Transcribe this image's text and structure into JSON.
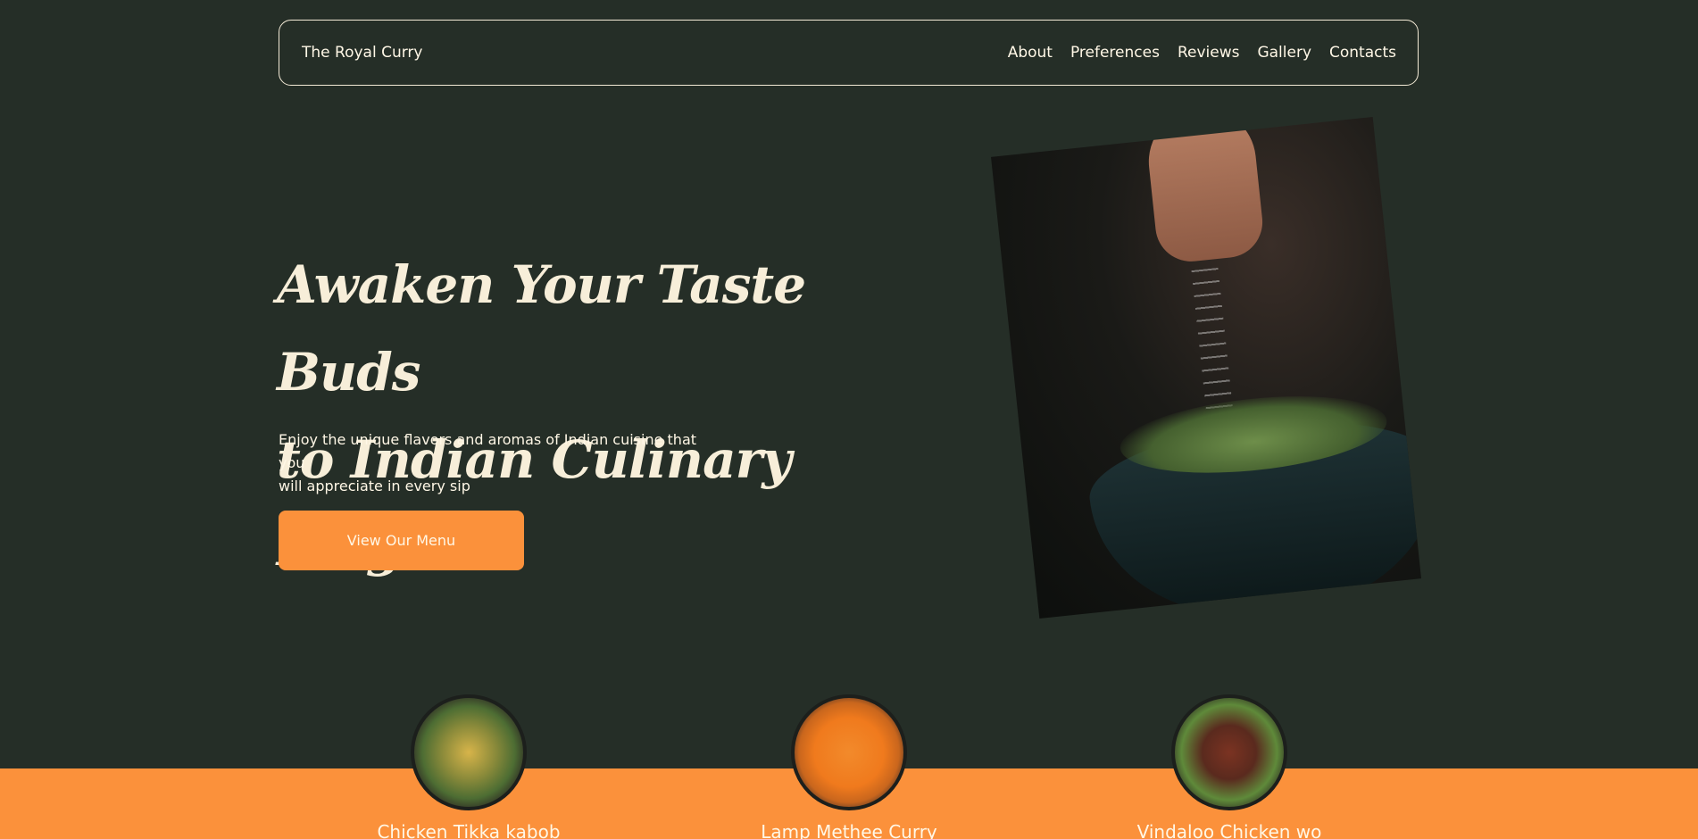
{
  "header": {
    "brand": "The Royal Curry",
    "nav": [
      "About",
      "Preferences",
      "Reviews",
      "Gallery",
      "Contacts"
    ]
  },
  "hero": {
    "title_line1": "Awaken Your Taste Buds",
    "title_line2": "to Indian Culinary Magic",
    "subtitle_line1": "Enjoy the unique flavors and aromas of Indian cuisine that you",
    "subtitle_line2": "will appreciate in every sip",
    "cta_label": "View Our Menu"
  },
  "dishes": [
    {
      "name": "Chicken Tikka kabob"
    },
    {
      "name": "Lamp Methee Curry"
    },
    {
      "name": "Vindaloo Chicken wo"
    }
  ],
  "colors": {
    "background": "#252e27",
    "accent": "#fb913b",
    "text": "#fff7e6"
  }
}
